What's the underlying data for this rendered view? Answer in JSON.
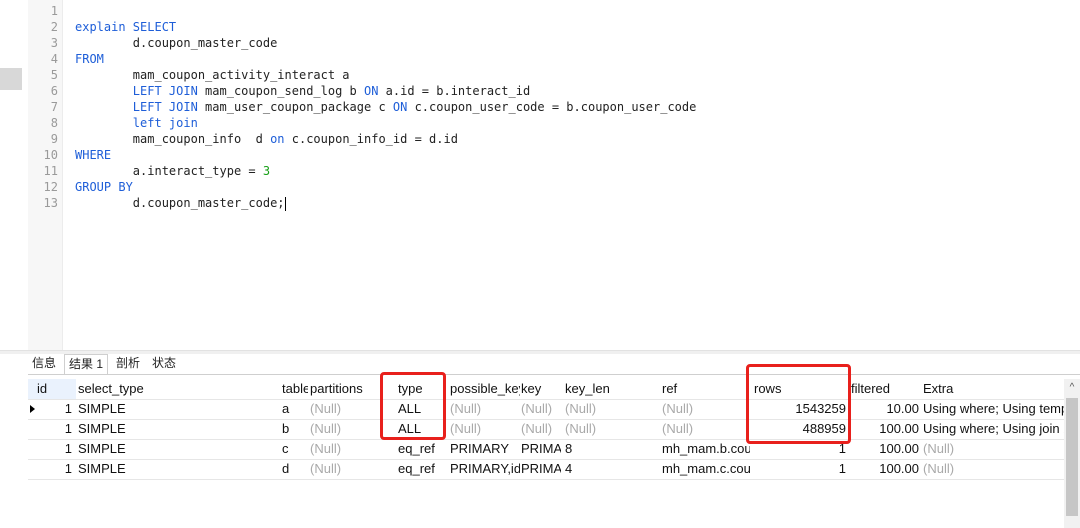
{
  "editor": {
    "lines": [
      {
        "no": "1",
        "tokens": []
      },
      {
        "no": "2",
        "tokens": [
          {
            "t": "explain SELECT",
            "c": "kw"
          }
        ]
      },
      {
        "no": "3",
        "tokens": [
          {
            "t": "        d.coupon_master_code",
            "c": "tx"
          }
        ]
      },
      {
        "no": "4",
        "tokens": [
          {
            "t": "FROM",
            "c": "kw"
          }
        ]
      },
      {
        "no": "5",
        "tokens": [
          {
            "t": "        mam_coupon_activity_interact a",
            "c": "tx"
          }
        ]
      },
      {
        "no": "6",
        "tokens": [
          {
            "t": "        ",
            "c": "tx"
          },
          {
            "t": "LEFT JOIN",
            "c": "kw"
          },
          {
            "t": " mam_coupon_send_log b ",
            "c": "tx"
          },
          {
            "t": "ON",
            "c": "kw"
          },
          {
            "t": " a.id = b.interact_id",
            "c": "tx"
          }
        ]
      },
      {
        "no": "7",
        "tokens": [
          {
            "t": "        ",
            "c": "tx"
          },
          {
            "t": "LEFT JOIN",
            "c": "kw"
          },
          {
            "t": " mam_user_coupon_package c ",
            "c": "tx"
          },
          {
            "t": "ON",
            "c": "kw"
          },
          {
            "t": " c.coupon_user_code = b.coupon_user_code",
            "c": "tx"
          }
        ]
      },
      {
        "no": "8",
        "tokens": [
          {
            "t": "        ",
            "c": "tx"
          },
          {
            "t": "left join",
            "c": "kw"
          }
        ]
      },
      {
        "no": "9",
        "tokens": [
          {
            "t": "        mam_coupon_info  d ",
            "c": "tx"
          },
          {
            "t": "on",
            "c": "kw"
          },
          {
            "t": " c.coupon_info_id = d.id",
            "c": "tx"
          }
        ]
      },
      {
        "no": "10",
        "tokens": [
          {
            "t": "WHERE",
            "c": "kw"
          }
        ]
      },
      {
        "no": "11",
        "tokens": [
          {
            "t": "        a.interact_type = ",
            "c": "tx"
          },
          {
            "t": "3",
            "c": "num"
          }
        ]
      },
      {
        "no": "12",
        "tokens": [
          {
            "t": "GROUP BY",
            "c": "kw"
          }
        ]
      },
      {
        "no": "13",
        "tokens": [
          {
            "t": "        d.coupon_master_code;",
            "c": "tx"
          }
        ],
        "caret": true
      }
    ]
  },
  "tabs": [
    "信息",
    "结果 1",
    "剖析",
    "状态"
  ],
  "active_tab": 1,
  "columns": [
    "id",
    "select_type",
    "table",
    "partitions",
    "type",
    "possible_keys",
    "key",
    "key_len",
    "ref",
    "rows",
    "filtered",
    "Extra"
  ],
  "rows": [
    [
      "1",
      "SIMPLE",
      "a",
      "(Null)",
      "ALL",
      "(Null)",
      "(Null)",
      "(Null)",
      "(Null)",
      "1543259",
      "10.00",
      "Using where; Using temporary"
    ],
    [
      "1",
      "SIMPLE",
      "b",
      "(Null)",
      "ALL",
      "(Null)",
      "(Null)",
      "(Null)",
      "(Null)",
      "488959",
      "100.00",
      "Using where; Using join buffer"
    ],
    [
      "1",
      "SIMPLE",
      "c",
      "(Null)",
      "eq_ref",
      "PRIMARY",
      "PRIMARY",
      "8",
      "mh_mam.b.coupon_user_code",
      "1",
      "100.00",
      "(Null)"
    ],
    [
      "1",
      "SIMPLE",
      "d",
      "(Null)",
      "eq_ref",
      "PRIMARY,idx",
      "PRIMARY",
      "4",
      "mh_mam.c.coupon_info_id",
      "1",
      "100.00",
      "(Null)"
    ]
  ],
  "colors": {
    "keyword": "#1e5ed8",
    "number": "#19a019",
    "highlight": "#e8201c",
    "null": "#a9a9a9"
  },
  "icons": {
    "row_marker": "triangle-right-icon",
    "scroll_up": "chevron-up-icon"
  }
}
